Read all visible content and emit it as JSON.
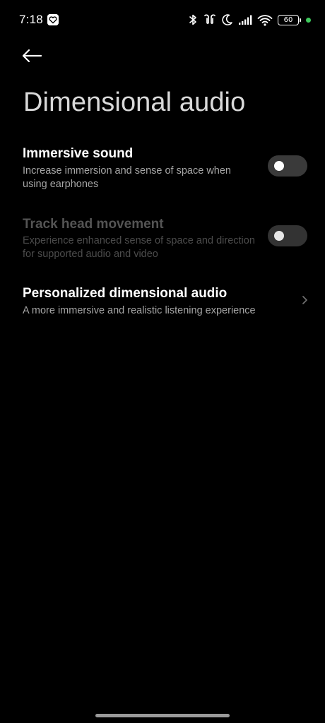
{
  "status_bar": {
    "time": "7:18",
    "battery_level": "60",
    "icons": [
      "heart-app-icon",
      "bluetooth-icon",
      "earbuds-icon",
      "moon-icon",
      "signal-icon",
      "wifi-icon",
      "battery-icon"
    ],
    "dot_color": "#3ec95c"
  },
  "header": {
    "back_icon": "back-arrow-icon",
    "title": "Dimensional audio"
  },
  "settings": [
    {
      "title": "Immersive sound",
      "description": "Increase immersion and sense of space when using earphones",
      "control": "toggle",
      "enabled": true,
      "value": "off"
    },
    {
      "title": "Track head movement",
      "description": "Experience enhanced sense of space and direction for supported audio and video",
      "control": "toggle",
      "enabled": false,
      "value": "off"
    },
    {
      "title": "Personalized dimensional audio",
      "description": "A more immersive and realistic listening experience",
      "control": "chevron",
      "enabled": true
    }
  ],
  "colors": {
    "background": "#000000",
    "title": "#d9d9d9",
    "primary_text": "#ffffff",
    "secondary_text": "#a6a6a6",
    "disabled_text": "#545454",
    "toggle_track": "#3a3a3a"
  }
}
